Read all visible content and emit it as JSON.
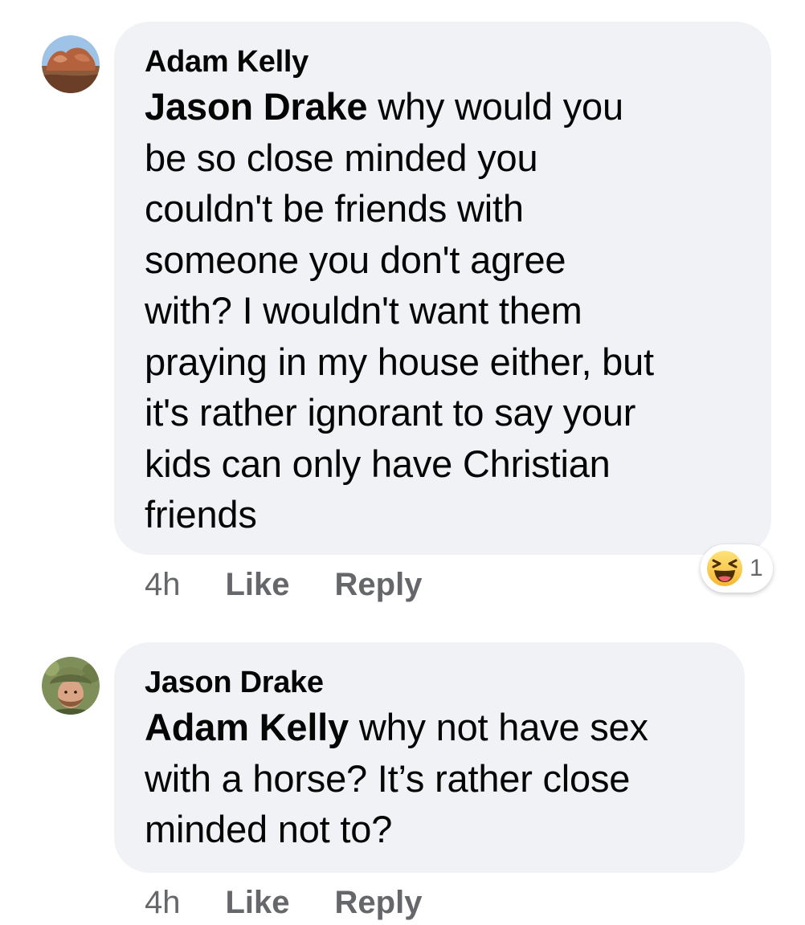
{
  "comments": [
    {
      "author": "Adam Kelly",
      "mention": "Jason Drake",
      "text_lines": [
        " why would you",
        "be so close minded you",
        "couldn't be friends with",
        "someone you don't agree",
        "with? I wouldn't want them",
        "praying in my house either, but",
        "it's rather ignorant to say your",
        "kids can only have Christian",
        "friends"
      ],
      "time": "4h",
      "like_label": "Like",
      "reply_label": "Reply",
      "reaction": {
        "icon": "haha-emoji-icon",
        "count": "1"
      }
    },
    {
      "author": "Jason Drake",
      "mention": "Adam Kelly",
      "text_lines": [
        " why not have sex",
        "with a horse? It’s rather close",
        "minded not to?"
      ],
      "time": "4h",
      "like_label": "Like",
      "reply_label": "Reply"
    }
  ],
  "colors": {
    "bubble": "#f0f2f5",
    "text": "#050505",
    "meta": "#65676b"
  }
}
